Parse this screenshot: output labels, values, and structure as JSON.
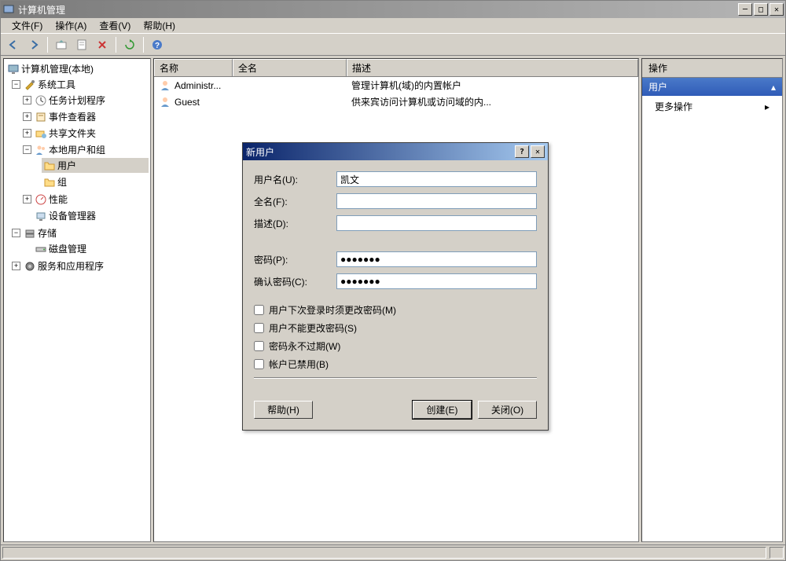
{
  "window": {
    "title": "计算机管理"
  },
  "menubar": {
    "file": "文件(F)",
    "action": "操作(A)",
    "view": "查看(V)",
    "help": "帮助(H)"
  },
  "tree": {
    "root": "计算机管理(本地)",
    "system_tools": "系统工具",
    "task_scheduler": "任务计划程序",
    "event_viewer": "事件查看器",
    "shared_folders": "共享文件夹",
    "local_users_groups": "本地用户和组",
    "users": "用户",
    "groups": "组",
    "performance": "性能",
    "device_manager": "设备管理器",
    "storage": "存储",
    "disk_management": "磁盘管理",
    "services_apps": "服务和应用程序"
  },
  "list": {
    "columns": {
      "name": "名称",
      "fullname": "全名",
      "description": "描述"
    },
    "rows": [
      {
        "name": "Administr...",
        "fullname": "",
        "description": "管理计算机(域)的内置帐户"
      },
      {
        "name": "Guest",
        "fullname": "",
        "description": "供来宾访问计算机或访问域的内..."
      }
    ]
  },
  "actions": {
    "header": "操作",
    "group": "用户",
    "more": "更多操作"
  },
  "dialog": {
    "title": "新用户",
    "labels": {
      "username": "用户名(U):",
      "fullname": "全名(F):",
      "description": "描述(D):",
      "password": "密码(P):",
      "confirm": "确认密码(C):"
    },
    "values": {
      "username": "凯文",
      "fullname": "",
      "description": "",
      "password": "●●●●●●●",
      "confirm": "●●●●●●●"
    },
    "checks": {
      "must_change": "用户下次登录时须更改密码(M)",
      "cannot_change": "用户不能更改密码(S)",
      "never_expires": "密码永不过期(W)",
      "disabled": "帐户已禁用(B)"
    },
    "buttons": {
      "help": "帮助(H)",
      "create": "创建(E)",
      "close": "关闭(O)"
    }
  }
}
